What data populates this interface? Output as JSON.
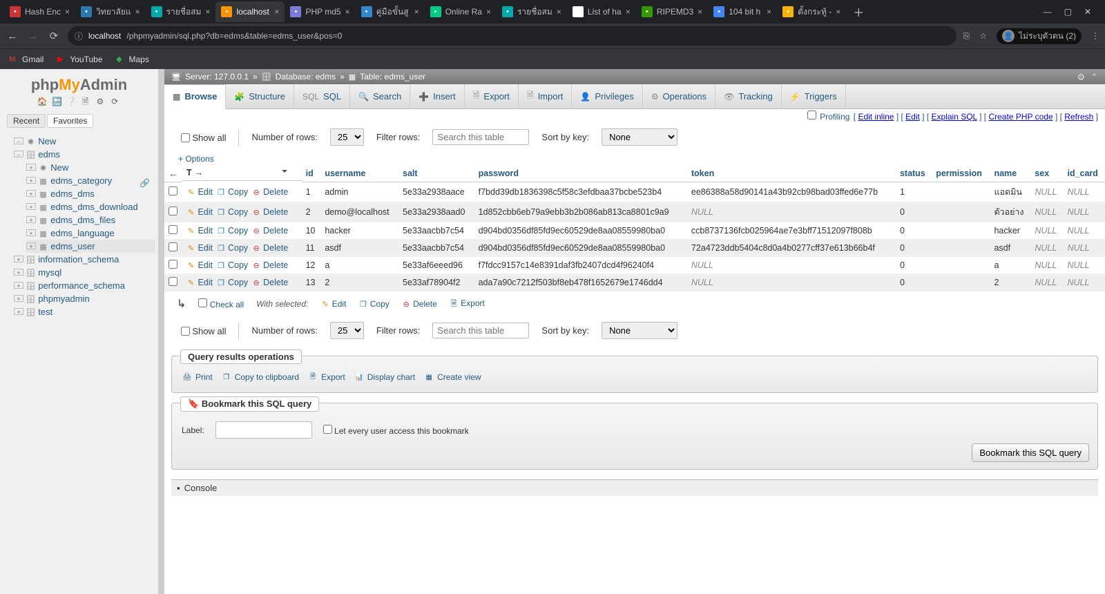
{
  "browser": {
    "tabs": [
      {
        "title": "Hash Enc",
        "fav": "#c33"
      },
      {
        "title": "วิทยาลัยแ",
        "fav": "#2a7ab0"
      },
      {
        "title": "รายชื่อสม",
        "fav": "#0aa"
      },
      {
        "title": "localhost",
        "fav": "#f89406",
        "active": true
      },
      {
        "title": "PHP md5",
        "fav": "#7b7bd8"
      },
      {
        "title": "คู่มือขั้นสู",
        "fav": "#38c"
      },
      {
        "title": "Online Ra",
        "fav": "#0c8"
      },
      {
        "title": "รายชื่อสม",
        "fav": "#0aa"
      },
      {
        "title": "List of ha",
        "fav": "#fff"
      },
      {
        "title": "RIPEMD3",
        "fav": "#390"
      },
      {
        "title": "104 bit h",
        "fav": "#4285f4"
      },
      {
        "title": "ตั้งกระทู้ -",
        "fav": "#f8b400"
      }
    ],
    "win": {
      "min": "—",
      "max": "▢",
      "close": "✕"
    },
    "url_host": "localhost",
    "url_path": "/phpmyadmin/sql.php?db=edms&table=edms_user&pos=0",
    "profile": "ไม่ระบุตัวตน (2)",
    "bookmarks": [
      {
        "icon": "M",
        "label": "Gmail",
        "color": "#e34133"
      },
      {
        "icon": "▶",
        "label": "YouTube",
        "color": "#ff0000"
      },
      {
        "icon": "◆",
        "label": "Maps",
        "color": "#34a853"
      }
    ]
  },
  "pma": {
    "logo": {
      "a": "php",
      "b": "My",
      "c": "Admin"
    },
    "recent": "Recent",
    "favorites": "Favorites",
    "tree": {
      "new": "New",
      "dbs": [
        {
          "name": "edms",
          "open": true,
          "tables": [
            {
              "name": "New",
              "new": true
            },
            {
              "name": "edms_category"
            },
            {
              "name": "edms_dms"
            },
            {
              "name": "edms_dms_download"
            },
            {
              "name": "edms_dms_files"
            },
            {
              "name": "edms_language"
            },
            {
              "name": "edms_user",
              "selected": true
            }
          ]
        },
        {
          "name": "information_schema"
        },
        {
          "name": "mysql"
        },
        {
          "name": "performance_schema"
        },
        {
          "name": "phpmyadmin"
        },
        {
          "name": "test"
        }
      ]
    },
    "breadcrumb": {
      "server": "Server: 127.0.0.1",
      "database": "Database: edms",
      "table": "Table: edms_user"
    },
    "tabs": [
      {
        "label": "Browse",
        "active": true
      },
      {
        "label": "Structure"
      },
      {
        "label": "SQL"
      },
      {
        "label": "Search"
      },
      {
        "label": "Insert"
      },
      {
        "label": "Export"
      },
      {
        "label": "Import"
      },
      {
        "label": "Privileges"
      },
      {
        "label": "Operations"
      },
      {
        "label": "Tracking"
      },
      {
        "label": "Triggers"
      }
    ],
    "hidden_links": {
      "profiling": "Profiling",
      "edit_inline": "Edit inline",
      "edit": "Edit",
      "explain": "Explain SQL",
      "create_php": "Create PHP code",
      "refresh": "Refresh"
    },
    "filter": {
      "show_all": "Show all",
      "rows_label": "Number of rows:",
      "rows_value": "25",
      "filter_label": "Filter rows:",
      "filter_placeholder": "Search this table",
      "sort_label": "Sort by key:",
      "sort_value": "None"
    },
    "options": "+ Options",
    "columns": [
      "id",
      "username",
      "salt",
      "password",
      "token",
      "status",
      "permission",
      "name",
      "sex",
      "id_card"
    ],
    "row_actions": {
      "edit": "Edit",
      "copy": "Copy",
      "delete": "Delete"
    },
    "rows": [
      {
        "id": "1",
        "username": "admin",
        "salt": "5e33a2938aace",
        "password": "f7bdd39db1836398c5f58c3efdbaa37bcbe523b4",
        "token": "ee86388a58d90141a43b92cb98bad03ffed6e77b",
        "status": "1",
        "permission": "",
        "name": "แอดมิน",
        "sex": "NULL",
        "id_card": "NULL"
      },
      {
        "id": "2",
        "username": "demo@localhost",
        "salt": "5e33a2938aad0",
        "password": "1d852cbb6eb79a9ebb3b2b086ab813ca8801c9a9",
        "token": "NULL",
        "status": "0",
        "permission": "",
        "name": "ตัวอย่าง",
        "sex": "NULL",
        "id_card": "NULL"
      },
      {
        "id": "10",
        "username": "hacker",
        "salt": "5e33aacbb7c54",
        "password": "d904bd0356df85fd9ec60529de8aa08559980ba0",
        "token": "ccb8737136fcb025964ae7e3bff71512097f808b",
        "status": "0",
        "permission": "",
        "name": "hacker",
        "sex": "NULL",
        "id_card": "NULL"
      },
      {
        "id": "11",
        "username": "asdf",
        "salt": "5e33aacbb7c54",
        "password": "d904bd0356df85fd9ec60529de8aa08559980ba0",
        "token": "72a4723ddb5404c8d0a4b0277cff37e613b66b4f",
        "status": "0",
        "permission": "",
        "name": "asdf",
        "sex": "NULL",
        "id_card": "NULL"
      },
      {
        "id": "12",
        "username": "a",
        "salt": "5e33af6eeed96",
        "password": "f7fdcc9157c14e8391daf3fb2407dcd4f96240f4",
        "token": "NULL",
        "status": "0",
        "permission": "",
        "name": "a",
        "sex": "NULL",
        "id_card": "NULL"
      },
      {
        "id": "13",
        "username": "2",
        "salt": "5e33af78904f2",
        "password": "ada7a90c7212f503bf8eb478f1652679e1746dd4",
        "token": "NULL",
        "status": "0",
        "permission": "",
        "name": "2",
        "sex": "NULL",
        "id_card": "NULL"
      }
    ],
    "batch": {
      "check_all": "Check all",
      "with_selected": "With selected:",
      "edit": "Edit",
      "copy": "Copy",
      "delete": "Delete",
      "export": "Export"
    },
    "ops_panel": {
      "title": "Query results operations",
      "print": "Print",
      "copy_cb": "Copy to clipboard",
      "export": "Export",
      "chart": "Display chart",
      "view": "Create view"
    },
    "bookmark_panel": {
      "title": "Bookmark this SQL query",
      "label": "Label:",
      "share": "Let every user access this bookmark",
      "button": "Bookmark this SQL query"
    },
    "console": "Console"
  }
}
